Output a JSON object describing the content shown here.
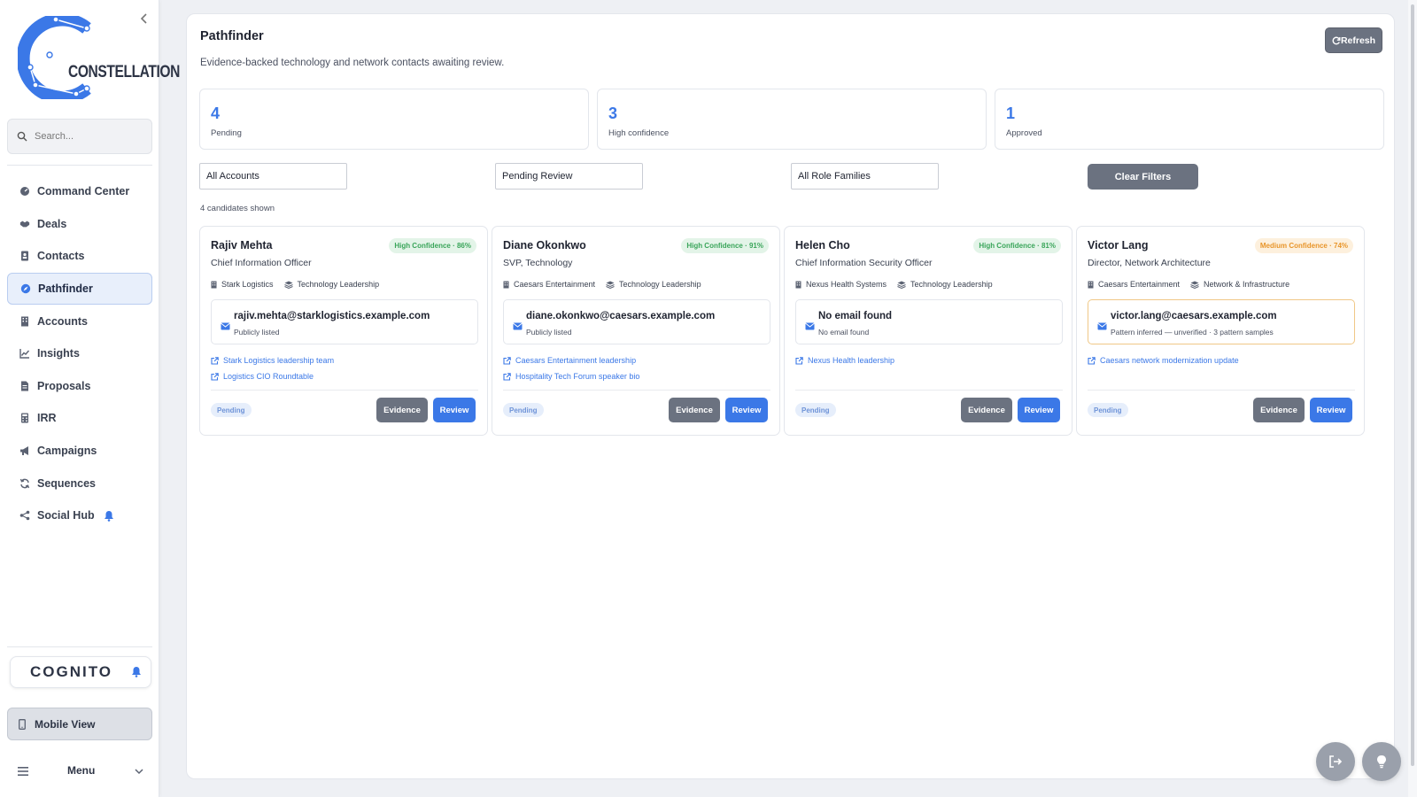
{
  "sidebar": {
    "logo_text": "CONSTELLATION",
    "search_placeholder": "Search...",
    "items": [
      {
        "label": "Command Center",
        "icon": "gauge-icon"
      },
      {
        "label": "Deals",
        "icon": "handshake-icon"
      },
      {
        "label": "Contacts",
        "icon": "address-book-icon"
      },
      {
        "label": "Pathfinder",
        "icon": "compass-icon",
        "active": true
      },
      {
        "label": "Accounts",
        "icon": "building-icon"
      },
      {
        "label": "Insights",
        "icon": "chart-line-icon"
      },
      {
        "label": "Proposals",
        "icon": "file-icon"
      },
      {
        "label": "IRR",
        "icon": "calculator-icon"
      },
      {
        "label": "Campaigns",
        "icon": "megaphone-icon"
      },
      {
        "label": "Sequences",
        "icon": "sync-icon"
      },
      {
        "label": "Social Hub",
        "icon": "share-icon"
      }
    ],
    "cognito_text": "COGNITO",
    "mobile_view_label": "Mobile View",
    "menu_label": "Menu"
  },
  "header": {
    "title": "Pathfinder",
    "subtitle": "Evidence-backed technology and network contacts awaiting review.",
    "refresh_label": "Refresh"
  },
  "stats": [
    {
      "value": "4",
      "label": "Pending"
    },
    {
      "value": "3",
      "label": "High confidence"
    },
    {
      "value": "1",
      "label": "Approved"
    }
  ],
  "filters": {
    "account": "All Accounts",
    "status": "Pending Review",
    "role_family": "All Role Families",
    "clear_label": "Clear Filters"
  },
  "candidate_count": "4 candidates shown",
  "colors": {
    "accent": "#3b78e7",
    "high_confidence": "#3aa55a",
    "medium_confidence": "#e8952a",
    "button_gray": "#6b7280"
  },
  "candidates": [
    {
      "name": "Rajiv Mehta",
      "title": "Chief Information Officer",
      "confidence": "High Confidence · 86%",
      "level": "high",
      "account": "Stark Logistics",
      "role_family": "Technology Leadership",
      "email": "rajiv.mehta@starklogistics.example.com",
      "email_note": "Publicly listed",
      "links": [
        "Stark Logistics leadership team",
        "Logistics CIO Roundtable"
      ],
      "status": "Pending",
      "evidence_label": "Evidence",
      "review_label": "Review"
    },
    {
      "name": "Diane Okonkwo",
      "title": "SVP, Technology",
      "confidence": "High Confidence · 91%",
      "level": "high",
      "account": "Caesars Entertainment",
      "role_family": "Technology Leadership",
      "email": "diane.okonkwo@caesars.example.com",
      "email_note": "Publicly listed",
      "links": [
        "Caesars Entertainment leadership",
        "Hospitality Tech Forum speaker bio"
      ],
      "status": "Pending",
      "evidence_label": "Evidence",
      "review_label": "Review"
    },
    {
      "name": "Helen Cho",
      "title": "Chief Information Security Officer",
      "confidence": "High Confidence · 81%",
      "level": "high",
      "account": "Nexus Health Systems",
      "role_family": "Technology Leadership",
      "email": "No email found",
      "email_note": "No email found",
      "links": [
        "Nexus Health leadership"
      ],
      "status": "Pending",
      "evidence_label": "Evidence",
      "review_label": "Review"
    },
    {
      "name": "Victor Lang",
      "title": "Director, Network Architecture",
      "confidence": "Medium Confidence · 74%",
      "level": "medium",
      "account": "Caesars Entertainment",
      "role_family": "Network & Infrastructure",
      "email": "victor.lang@caesars.example.com",
      "email_note": "Pattern inferred — unverified · 3 pattern samples",
      "links": [
        "Caesars network modernization update"
      ],
      "status": "Pending",
      "evidence_label": "Evidence",
      "review_label": "Review"
    }
  ]
}
